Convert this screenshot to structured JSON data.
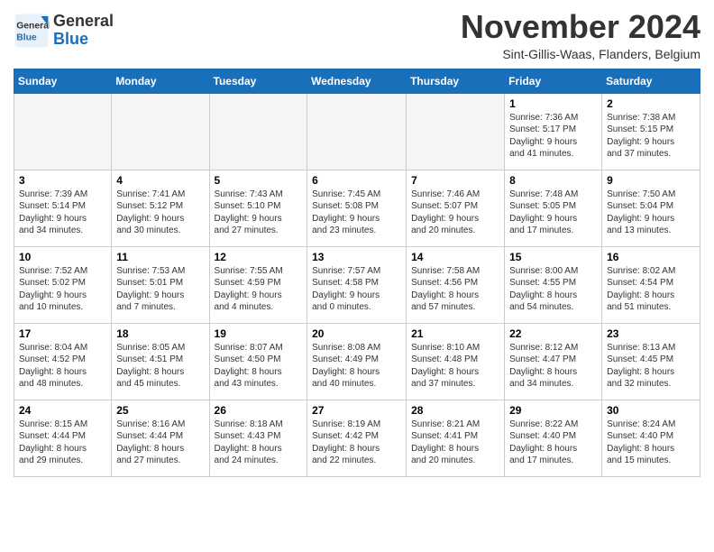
{
  "logo": {
    "general": "General",
    "blue": "Blue"
  },
  "title": "November 2024",
  "location": "Sint-Gillis-Waas, Flanders, Belgium",
  "days_of_week": [
    "Sunday",
    "Monday",
    "Tuesday",
    "Wednesday",
    "Thursday",
    "Friday",
    "Saturday"
  ],
  "weeks": [
    [
      {
        "day": "",
        "info": ""
      },
      {
        "day": "",
        "info": ""
      },
      {
        "day": "",
        "info": ""
      },
      {
        "day": "",
        "info": ""
      },
      {
        "day": "",
        "info": ""
      },
      {
        "day": "1",
        "info": "Sunrise: 7:36 AM\nSunset: 5:17 PM\nDaylight: 9 hours\nand 41 minutes."
      },
      {
        "day": "2",
        "info": "Sunrise: 7:38 AM\nSunset: 5:15 PM\nDaylight: 9 hours\nand 37 minutes."
      }
    ],
    [
      {
        "day": "3",
        "info": "Sunrise: 7:39 AM\nSunset: 5:14 PM\nDaylight: 9 hours\nand 34 minutes."
      },
      {
        "day": "4",
        "info": "Sunrise: 7:41 AM\nSunset: 5:12 PM\nDaylight: 9 hours\nand 30 minutes."
      },
      {
        "day": "5",
        "info": "Sunrise: 7:43 AM\nSunset: 5:10 PM\nDaylight: 9 hours\nand 27 minutes."
      },
      {
        "day": "6",
        "info": "Sunrise: 7:45 AM\nSunset: 5:08 PM\nDaylight: 9 hours\nand 23 minutes."
      },
      {
        "day": "7",
        "info": "Sunrise: 7:46 AM\nSunset: 5:07 PM\nDaylight: 9 hours\nand 20 minutes."
      },
      {
        "day": "8",
        "info": "Sunrise: 7:48 AM\nSunset: 5:05 PM\nDaylight: 9 hours\nand 17 minutes."
      },
      {
        "day": "9",
        "info": "Sunrise: 7:50 AM\nSunset: 5:04 PM\nDaylight: 9 hours\nand 13 minutes."
      }
    ],
    [
      {
        "day": "10",
        "info": "Sunrise: 7:52 AM\nSunset: 5:02 PM\nDaylight: 9 hours\nand 10 minutes."
      },
      {
        "day": "11",
        "info": "Sunrise: 7:53 AM\nSunset: 5:01 PM\nDaylight: 9 hours\nand 7 minutes."
      },
      {
        "day": "12",
        "info": "Sunrise: 7:55 AM\nSunset: 4:59 PM\nDaylight: 9 hours\nand 4 minutes."
      },
      {
        "day": "13",
        "info": "Sunrise: 7:57 AM\nSunset: 4:58 PM\nDaylight: 9 hours\nand 0 minutes."
      },
      {
        "day": "14",
        "info": "Sunrise: 7:58 AM\nSunset: 4:56 PM\nDaylight: 8 hours\nand 57 minutes."
      },
      {
        "day": "15",
        "info": "Sunrise: 8:00 AM\nSunset: 4:55 PM\nDaylight: 8 hours\nand 54 minutes."
      },
      {
        "day": "16",
        "info": "Sunrise: 8:02 AM\nSunset: 4:54 PM\nDaylight: 8 hours\nand 51 minutes."
      }
    ],
    [
      {
        "day": "17",
        "info": "Sunrise: 8:04 AM\nSunset: 4:52 PM\nDaylight: 8 hours\nand 48 minutes."
      },
      {
        "day": "18",
        "info": "Sunrise: 8:05 AM\nSunset: 4:51 PM\nDaylight: 8 hours\nand 45 minutes."
      },
      {
        "day": "19",
        "info": "Sunrise: 8:07 AM\nSunset: 4:50 PM\nDaylight: 8 hours\nand 43 minutes."
      },
      {
        "day": "20",
        "info": "Sunrise: 8:08 AM\nSunset: 4:49 PM\nDaylight: 8 hours\nand 40 minutes."
      },
      {
        "day": "21",
        "info": "Sunrise: 8:10 AM\nSunset: 4:48 PM\nDaylight: 8 hours\nand 37 minutes."
      },
      {
        "day": "22",
        "info": "Sunrise: 8:12 AM\nSunset: 4:47 PM\nDaylight: 8 hours\nand 34 minutes."
      },
      {
        "day": "23",
        "info": "Sunrise: 8:13 AM\nSunset: 4:45 PM\nDaylight: 8 hours\nand 32 minutes."
      }
    ],
    [
      {
        "day": "24",
        "info": "Sunrise: 8:15 AM\nSunset: 4:44 PM\nDaylight: 8 hours\nand 29 minutes."
      },
      {
        "day": "25",
        "info": "Sunrise: 8:16 AM\nSunset: 4:44 PM\nDaylight: 8 hours\nand 27 minutes."
      },
      {
        "day": "26",
        "info": "Sunrise: 8:18 AM\nSunset: 4:43 PM\nDaylight: 8 hours\nand 24 minutes."
      },
      {
        "day": "27",
        "info": "Sunrise: 8:19 AM\nSunset: 4:42 PM\nDaylight: 8 hours\nand 22 minutes."
      },
      {
        "day": "28",
        "info": "Sunrise: 8:21 AM\nSunset: 4:41 PM\nDaylight: 8 hours\nand 20 minutes."
      },
      {
        "day": "29",
        "info": "Sunrise: 8:22 AM\nSunset: 4:40 PM\nDaylight: 8 hours\nand 17 minutes."
      },
      {
        "day": "30",
        "info": "Sunrise: 8:24 AM\nSunset: 4:40 PM\nDaylight: 8 hours\nand 15 minutes."
      }
    ]
  ]
}
